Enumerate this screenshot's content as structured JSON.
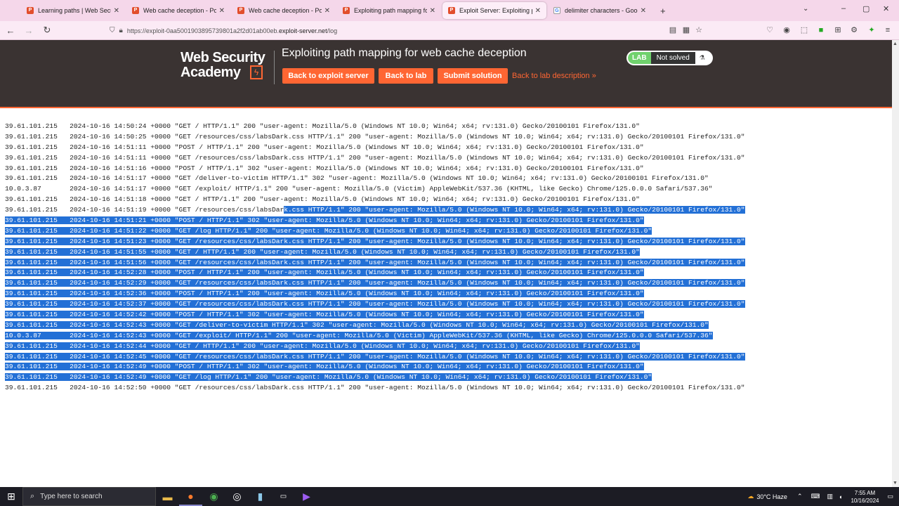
{
  "browser": {
    "tabs": [
      {
        "title": "Learning paths | Web Security A",
        "icon": "portswigger",
        "active": false
      },
      {
        "title": "Web cache deception - PortSwi",
        "icon": "portswigger",
        "active": false
      },
      {
        "title": "Web cache deception - PortSwi",
        "icon": "portswigger",
        "active": false
      },
      {
        "title": "Exploiting path mapping for we",
        "icon": "portswigger",
        "active": false
      },
      {
        "title": "Exploit Server: Exploiting path",
        "icon": "portswigger",
        "active": true
      },
      {
        "title": "delimiter characters - Google S",
        "icon": "google",
        "active": false
      }
    ],
    "url_prefix": "https://exploit-0aa5001903895739801a2f2d01ab00eb.",
    "url_host": "exploit-server.net",
    "url_path": "/log"
  },
  "header": {
    "logo_line1": "Web Security",
    "logo_line2": "Academy",
    "title": "Exploiting path mapping for web cache deception",
    "btn_exploit": "Back to exploit server",
    "btn_lab": "Back to lab",
    "btn_submit": "Submit solution",
    "desc_link": "Back to lab description »",
    "badge_lab": "LAB",
    "badge_status": "Not solved"
  },
  "log": [
    {
      "text": "39.61.101.215   2024-10-16 14:50:24 +0000 \"GET / HTTP/1.1\" 200 \"user-agent: Mozilla/5.0 (Windows NT 10.0; Win64; x64; rv:131.0) Gecko/20100101 Firefox/131.0\"",
      "sel": "none"
    },
    {
      "text": "39.61.101.215   2024-10-16 14:50:25 +0000 \"GET /resources/css/labsDark.css HTTP/1.1\" 200 \"user-agent: Mozilla/5.0 (Windows NT 10.0; Win64; x64; rv:131.0) Gecko/20100101 Firefox/131.0\"",
      "sel": "none"
    },
    {
      "text": "39.61.101.215   2024-10-16 14:51:11 +0000 \"POST / HTTP/1.1\" 200 \"user-agent: Mozilla/5.0 (Windows NT 10.0; Win64; x64; rv:131.0) Gecko/20100101 Firefox/131.0\"",
      "sel": "none"
    },
    {
      "text": "39.61.101.215   2024-10-16 14:51:11 +0000 \"GET /resources/css/labsDark.css HTTP/1.1\" 200 \"user-agent: Mozilla/5.0 (Windows NT 10.0; Win64; x64; rv:131.0) Gecko/20100101 Firefox/131.0\"",
      "sel": "none"
    },
    {
      "text": "39.61.101.215   2024-10-16 14:51:16 +0000 \"POST / HTTP/1.1\" 302 \"user-agent: Mozilla/5.0 (Windows NT 10.0; Win64; x64; rv:131.0) Gecko/20100101 Firefox/131.0\"",
      "sel": "none"
    },
    {
      "text": "39.61.101.215   2024-10-16 14:51:17 +0000 \"GET /deliver-to-victim HTTP/1.1\" 302 \"user-agent: Mozilla/5.0 (Windows NT 10.0; Win64; x64; rv:131.0) Gecko/20100101 Firefox/131.0\"",
      "sel": "none"
    },
    {
      "text": "10.0.3.87       2024-10-16 14:51:17 +0000 \"GET /exploit/ HTTP/1.1\" 200 \"user-agent: Mozilla/5.0 (Victim) AppleWebKit/537.36 (KHTML, like Gecko) Chrome/125.0.0.0 Safari/537.36\"",
      "sel": "none"
    },
    {
      "text": "39.61.101.215   2024-10-16 14:51:18 +0000 \"GET / HTTP/1.1\" 200 \"user-agent: Mozilla/5.0 (Windows NT 10.0; Win64; x64; rv:131.0) Gecko/20100101 Firefox/131.0\"",
      "sel": "none"
    },
    {
      "text": "39.61.101.215   2024-10-16 14:51:19 +0000 \"GET /resources/css/labsDark.css HTTP/1.1\" 200 \"user-agent: Mozilla/5.0 (Windows NT 10.0; Win64; x64; rv:131.0) Gecko/20100101 Firefox/131.0\"",
      "sel": "partial",
      "split": 69
    },
    {
      "text": "39.61.101.215   2024-10-16 14:51:21 +0000 \"POST / HTTP/1.1\" 302 \"user-agent: Mozilla/5.0 (Windows NT 10.0; Win64; x64; rv:131.0) Gecko/20100101 Firefox/131.0\"",
      "sel": "full"
    },
    {
      "text": "39.61.101.215   2024-10-16 14:51:22 +0000 \"GET /log HTTP/1.1\" 200 \"user-agent: Mozilla/5.0 (Windows NT 10.0; Win64; x64; rv:131.0) Gecko/20100101 Firefox/131.0\"",
      "sel": "full"
    },
    {
      "text": "39.61.101.215   2024-10-16 14:51:23 +0000 \"GET /resources/css/labsDark.css HTTP/1.1\" 200 \"user-agent: Mozilla/5.0 (Windows NT 10.0; Win64; x64; rv:131.0) Gecko/20100101 Firefox/131.0\"",
      "sel": "full"
    },
    {
      "text": "39.61.101.215   2024-10-16 14:51:55 +0000 \"GET / HTTP/1.1\" 200 \"user-agent: Mozilla/5.0 (Windows NT 10.0; Win64; x64; rv:131.0) Gecko/20100101 Firefox/131.0\"",
      "sel": "full"
    },
    {
      "text": "39.61.101.215   2024-10-16 14:51:56 +0000 \"GET /resources/css/labsDark.css HTTP/1.1\" 200 \"user-agent: Mozilla/5.0 (Windows NT 10.0; Win64; x64; rv:131.0) Gecko/20100101 Firefox/131.0\"",
      "sel": "full"
    },
    {
      "text": "39.61.101.215   2024-10-16 14:52:28 +0000 \"POST / HTTP/1.1\" 200 \"user-agent: Mozilla/5.0 (Windows NT 10.0; Win64; x64; rv:131.0) Gecko/20100101 Firefox/131.0\"",
      "sel": "full"
    },
    {
      "text": "39.61.101.215   2024-10-16 14:52:29 +0000 \"GET /resources/css/labsDark.css HTTP/1.1\" 200 \"user-agent: Mozilla/5.0 (Windows NT 10.0; Win64; x64; rv:131.0) Gecko/20100101 Firefox/131.0\"",
      "sel": "full"
    },
    {
      "text": "39.61.101.215   2024-10-16 14:52:36 +0000 \"POST / HTTP/1.1\" 200 \"user-agent: Mozilla/5.0 (Windows NT 10.0; Win64; x64; rv:131.0) Gecko/20100101 Firefox/131.0\"",
      "sel": "full"
    },
    {
      "text": "39.61.101.215   2024-10-16 14:52:37 +0000 \"GET /resources/css/labsDark.css HTTP/1.1\" 200 \"user-agent: Mozilla/5.0 (Windows NT 10.0; Win64; x64; rv:131.0) Gecko/20100101 Firefox/131.0\"",
      "sel": "full"
    },
    {
      "text": "39.61.101.215   2024-10-16 14:52:42 +0000 \"POST / HTTP/1.1\" 302 \"user-agent: Mozilla/5.0 (Windows NT 10.0; Win64; x64; rv:131.0) Gecko/20100101 Firefox/131.0\"",
      "sel": "full"
    },
    {
      "text": "39.61.101.215   2024-10-16 14:52:43 +0000 \"GET /deliver-to-victim HTTP/1.1\" 302 \"user-agent: Mozilla/5.0 (Windows NT 10.0; Win64; x64; rv:131.0) Gecko/20100101 Firefox/131.0\"",
      "sel": "full"
    },
    {
      "text": "10.0.3.87       2024-10-16 14:52:43 +0000 \"GET /exploit/ HTTP/1.1\" 200 \"user-agent: Mozilla/5.0 (Victim) AppleWebKit/537.36 (KHTML, like Gecko) Chrome/125.0.0.0 Safari/537.36\"",
      "sel": "full"
    },
    {
      "text": "39.61.101.215   2024-10-16 14:52:44 +0000 \"GET / HTTP/1.1\" 200 \"user-agent: Mozilla/5.0 (Windows NT 10.0; Win64; x64; rv:131.0) Gecko/20100101 Firefox/131.0\"",
      "sel": "full"
    },
    {
      "text": "39.61.101.215   2024-10-16 14:52:45 +0000 \"GET /resources/css/labsDark.css HTTP/1.1\" 200 \"user-agent: Mozilla/5.0 (Windows NT 10.0; Win64; x64; rv:131.0) Gecko/20100101 Firefox/131.0\"",
      "sel": "full"
    },
    {
      "text": "39.61.101.215   2024-10-16 14:52:49 +0000 \"POST / HTTP/1.1\" 302 \"user-agent: Mozilla/5.0 (Windows NT 10.0; Win64; x64; rv:131.0) Gecko/20100101 Firefox/131.0\"",
      "sel": "full"
    },
    {
      "text": "39.61.101.215   2024-10-16 14:52:49 +0000 \"GET /log HTTP/1.1\" 200 \"user-agent: Mozilla/5.0 (Windows NT 10.0; Win64; x64; rv:131.0) Gecko/20100101 Firefox/131.0\"",
      "sel": "full"
    },
    {
      "text": "39.61.101.215   2024-10-16 14:52:50 +0000 \"GET /resources/css/labsDark.css HTTP/1.1\" 200 \"user-agent: Mozilla/5.0 (Windows NT 10.0; Win64; x64; rv:131.0) Gecko/20100101 Firefox/131.0\"",
      "sel": "none"
    }
  ],
  "taskbar": {
    "search_placeholder": "Type here to search",
    "weather": "30°C  Haze",
    "time": "7:55 AM",
    "date": "10/16/2024"
  },
  "colors": {
    "accent": "#ff6633",
    "selection": "#2370d6",
    "header_bg": "#3a3332",
    "badge_green": "#70d16d"
  }
}
